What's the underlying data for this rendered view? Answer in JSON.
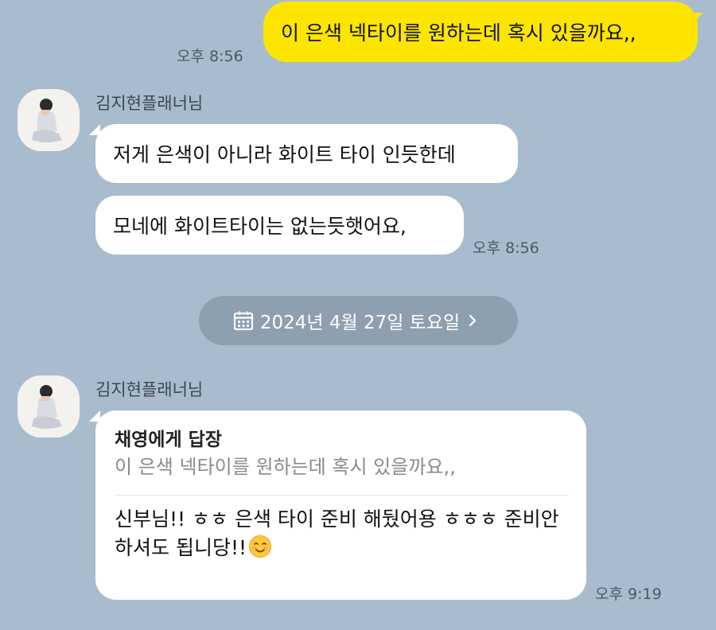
{
  "messages": {
    "outgoing": {
      "text": "이 은색 넥타이를 원하는데 혹시 있을까요,,",
      "time": "오후 8:56"
    },
    "group1": {
      "sender": "김지현플래너님",
      "bubbles": [
        "저게 은색이 아니라 화이트 타이 인듯한데",
        "모네에 화이트타이는 없는듯햇어요,"
      ],
      "time": "오후 8:56"
    },
    "date_divider": {
      "label": "2024년 4월 27일 토요일",
      "icon": "calendar-icon",
      "chevron": "chevron-right-icon"
    },
    "group2": {
      "sender": "김지현플래너님",
      "reply_to": "채영에게 답장",
      "quoted": "이 은색 넥타이를 원하는데 혹시 있을까요,,",
      "body": "신부님!! ㅎㅎ 은색 타이 준비 해뒀어용 ㅎㅎㅎ 준비안하셔도 됩니당!!",
      "emoji": "smiling-face-emoji",
      "time": "오후 9:19"
    }
  },
  "colors": {
    "background": "#a9bccd",
    "mine_bubble": "#fee500",
    "other_bubble": "#ffffff",
    "date_pill": "#8e9fb0"
  }
}
